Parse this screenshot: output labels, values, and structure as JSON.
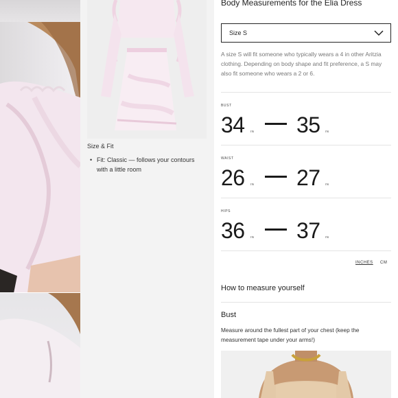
{
  "sizing": {
    "title": "Body Measurements for the Elia Dress",
    "selected_size": "Size S",
    "description": "A size S will fit someone who typically wears a 4 in other Aritzia clothing. Depending on body shape and fit preference, a S may also fit someone who wears a 2 or 6.",
    "unit_label": "IN",
    "measurements": [
      {
        "label": "BUST",
        "min": "34",
        "max": "35"
      },
      {
        "label": "WAIST",
        "min": "26",
        "max": "27"
      },
      {
        "label": "HIPS",
        "min": "36",
        "max": "37"
      }
    ],
    "units": {
      "inches": "INCHES",
      "cm": "CM"
    }
  },
  "fit": {
    "title": "Size & Fit",
    "items": [
      "Fit: Classic — follows your contours with a little room"
    ]
  },
  "howto": {
    "title": "How to measure yourself",
    "bust_title": "Bust",
    "bust_text": "Measure around the fullest part of your chest (keep the measurement tape under your arms!)"
  },
  "icons": {
    "select": "chevron-down-icon"
  },
  "colors": {
    "panel_grey": "#f3f3f3",
    "text": "#1a1a1a",
    "muted": "#777777",
    "divider": "#e4e4e4",
    "tank_top": "#e3c9a8",
    "necklace": "#c9a13b"
  }
}
